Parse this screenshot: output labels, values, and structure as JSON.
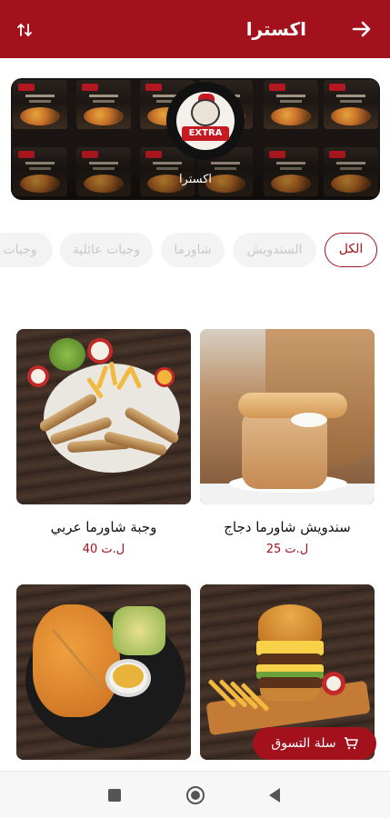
{
  "header": {
    "title": "اكسترا",
    "back_icon": "arrow-right-icon",
    "sort_icon": "sort-icon",
    "bg_color": "#a3121c"
  },
  "banner": {
    "brand_name": "اكسترا",
    "logo_text": "EXTRA"
  },
  "categories": [
    {
      "label": "الكل",
      "active": true
    },
    {
      "label": "السندويش",
      "active": false
    },
    {
      "label": "شاورما",
      "active": false
    },
    {
      "label": "وجبات عائلية",
      "active": false
    },
    {
      "label": "وجبات",
      "active": false
    }
  ],
  "products": [
    {
      "name": "سندويش شاورما دجاج",
      "price": "25 ل.ت"
    },
    {
      "name": "وجبة شاورما عربي",
      "price": "40 ل.ت"
    },
    {
      "name": "",
      "price": ""
    },
    {
      "name": "",
      "price": ""
    }
  ],
  "cart": {
    "label": "سلة التسوق",
    "icon": "cart-icon"
  },
  "navigation": {
    "recents_icon": "square-icon",
    "home_icon": "circle-icon",
    "back_icon": "triangle-back-icon"
  },
  "colors": {
    "accent": "#a3121c",
    "chip_bg": "#f3f3f3",
    "chip_text": "#c9c9c9"
  }
}
